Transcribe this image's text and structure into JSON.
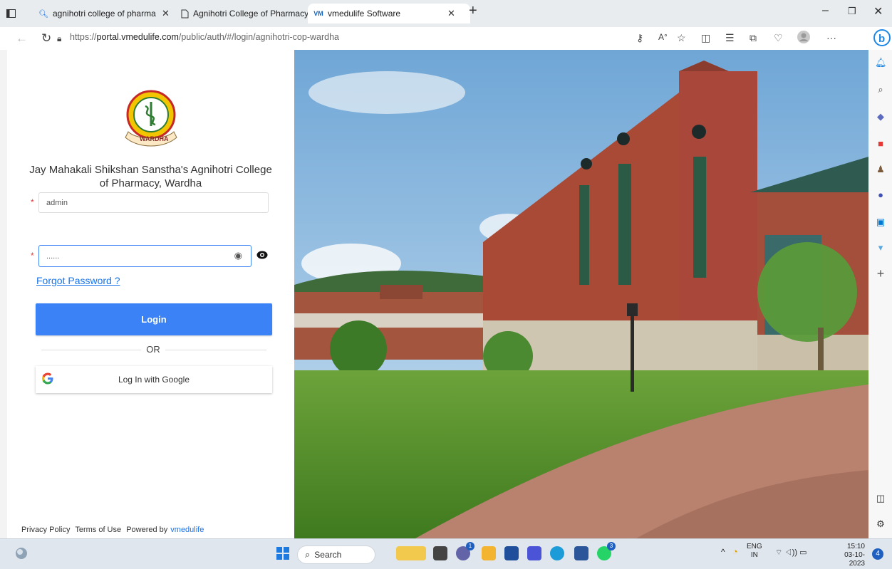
{
  "browser": {
    "tabs": [
      {
        "label": "agnihotri college of pharmacy w",
        "icon": "search-icon"
      },
      {
        "label": "Agnihotri College of Pharmacy",
        "icon": "page-icon"
      },
      {
        "label": "vmedulife Software",
        "icon": "vm-icon"
      }
    ],
    "url_prefix": "https://",
    "url_domain": "portal.vmedulife.com",
    "url_path": "/public/auth/#/login/agnihotri-cop-wardha"
  },
  "login": {
    "college_name": "Jay Mahakali Shikshan Sanstha's Agnihotri College of Pharmacy, Wardha",
    "logo_text": "AGNIHOTRI COLLEGE OF PHARMACY",
    "logo_bottom": "WARDHA",
    "username_value": "admin",
    "password_value": "......",
    "required_marker": "*",
    "forgot_label": "Forgot Password ?",
    "login_label": "Login",
    "or_label": "OR",
    "google_label": "Log In with Google",
    "google_glyph": "G"
  },
  "footer": {
    "privacy": "Privacy Policy",
    "terms": "Terms of Use",
    "powered": "Powered by",
    "brand": "vmedulife"
  },
  "taskbar": {
    "search_label": "Search",
    "lang_line1": "ENG",
    "lang_line2": "IN",
    "time": "15:10",
    "date": "03-10-2023",
    "notification_count": "4",
    "badge_teams": "1",
    "badge_whatsapp": "3"
  },
  "colors": {
    "accent": "#3b82f6",
    "link": "#1a73e8",
    "required": "#e53935"
  }
}
